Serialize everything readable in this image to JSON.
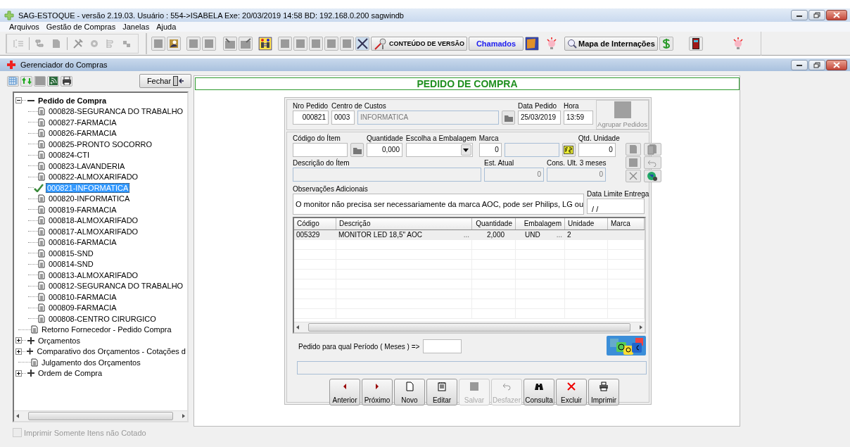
{
  "window": {
    "title": "SAG-ESTOQUE - versão 2.19.03.   Usuário : 554->ISABELA Exe: 20/03/2019 14:58 BD: 192.168.0.200 sagwindb"
  },
  "menu": [
    "Arquivos",
    "Gestão de Compras",
    "Janelas",
    "Ajuda"
  ],
  "toolbar": {
    "version_button": "CONTEÚDO DE VERSÃO",
    "tickets_button": "Chamados",
    "map_button": "Mapa de Internações"
  },
  "child_window": {
    "title": "Gerenciador do Compras"
  },
  "sidebar": {
    "close_button": "Fechar",
    "tree": [
      {
        "label": "Pedido de Compra",
        "kind": "group",
        "expanded": true,
        "children": [
          {
            "label": "000828-SEGURANCA DO TRABALHO",
            "selected": false
          },
          {
            "label": "000827-FARMACIA",
            "selected": false
          },
          {
            "label": "000826-FARMACIA",
            "selected": false
          },
          {
            "label": "000825-PRONTO SOCORRO",
            "selected": false
          },
          {
            "label": "000824-CTI",
            "selected": false
          },
          {
            "label": "000823-LAVANDERIA",
            "selected": false
          },
          {
            "label": "000822-ALMOXARIFADO",
            "selected": false
          },
          {
            "label": "000821-INFORMATICA",
            "selected": true
          },
          {
            "label": "000820-INFORMATICA",
            "selected": false
          },
          {
            "label": "000819-FARMACIA",
            "selected": false
          },
          {
            "label": "000818-ALMOXARIFADO",
            "selected": false
          },
          {
            "label": "000817-ALMOXARIFADO",
            "selected": false
          },
          {
            "label": "000816-FARMACIA",
            "selected": false
          },
          {
            "label": "000815-SND",
            "selected": false
          },
          {
            "label": "000814-SND",
            "selected": false
          },
          {
            "label": "000813-ALMOXARIFADO",
            "selected": false
          },
          {
            "label": "000812-SEGURANCA DO TRABALHO",
            "selected": false
          },
          {
            "label": "000810-FARMACIA",
            "selected": false
          },
          {
            "label": "000809-FARMACIA",
            "selected": false
          },
          {
            "label": "000808-CENTRO CIRURGICO",
            "selected": false
          }
        ]
      },
      {
        "label": "Retorno Fornecedor - Pedido Compra",
        "kind": "leaf"
      },
      {
        "label": "Orçamentos",
        "kind": "group",
        "expanded": false
      },
      {
        "label": "Comparativo dos Orçamentos - Cotações d",
        "kind": "group",
        "expanded": false
      },
      {
        "label": "Julgamento dos Orçamentos",
        "kind": "leaf"
      },
      {
        "label": "Ordem de Compra",
        "kind": "group",
        "expanded": false
      }
    ],
    "checkbox": {
      "label": "Imprimir Somente Itens não Cotado",
      "checked": false,
      "disabled": true
    }
  },
  "form": {
    "title": "PEDIDO DE COMPRA",
    "order_number": {
      "label": "Nro Pedido",
      "value": "000821"
    },
    "cost_center": {
      "label": "Centro de Custos",
      "code": "0003",
      "name": "INFORMATICA"
    },
    "order_date": {
      "label": "Data Pedido",
      "value": "25/03/2019"
    },
    "time": {
      "label": "Hora",
      "value": "13:59"
    },
    "group_button": "Agrupar Pedidos",
    "item_code": {
      "label": "Código do Ítem"
    },
    "quantity": {
      "label": "Quantidade",
      "value": "0,000"
    },
    "packaging": {
      "label": "Escolha a Embalagem"
    },
    "brand": {
      "label": "Marca",
      "value": "0"
    },
    "unit_qty": {
      "label": "Qtd. Unidade",
      "value": "0"
    },
    "description": {
      "label": "Descrição do Ítem"
    },
    "stock": {
      "label": "Est. Atual",
      "value": "0"
    },
    "consumption": {
      "label": "Cons. Ult. 3 meses",
      "value": "0"
    },
    "notes": {
      "label": "Observações Adicionais",
      "value": "O monitor não precisa ser necessariamente da marca AOC, pode ser Philips, LG ou"
    },
    "deadline": {
      "label": "Data Limite Entrega",
      "value": " / /"
    },
    "table": {
      "columns": [
        "Código",
        "Descrição",
        "Quantidade",
        "Embalagem",
        "Unidade",
        "Marca"
      ],
      "rows": [
        {
          "code": "005329",
          "description": "MONITOR LED 18,5\" AOC",
          "description_button": "...",
          "quantity": "2,000",
          "packaging": "UND",
          "packaging_button": "...",
          "unit": "2",
          "selected": true
        }
      ]
    },
    "period": {
      "label": "Pedido para qual Período ( Meses ) =>"
    },
    "buttons": [
      {
        "label": "Anterior",
        "kind": "prev",
        "disabled": false
      },
      {
        "label": "Próximo",
        "kind": "next",
        "disabled": false
      },
      {
        "label": "Novo",
        "kind": "new",
        "disabled": false
      },
      {
        "label": "Editar",
        "kind": "edit",
        "disabled": false
      },
      {
        "label": "Salvar",
        "kind": "save",
        "disabled": true
      },
      {
        "label": "Desfazer",
        "kind": "undo",
        "disabled": true
      },
      {
        "label": "Consulta",
        "kind": "search",
        "disabled": false
      },
      {
        "label": "Excluir",
        "kind": "delete",
        "disabled": false
      },
      {
        "label": "Imprimir",
        "kind": "print",
        "disabled": false
      }
    ]
  }
}
